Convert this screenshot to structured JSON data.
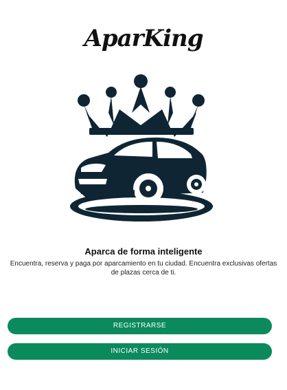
{
  "app": {
    "logo_text": "AparKing"
  },
  "hero": {
    "illustration": "crown-car-logo-icon"
  },
  "tagline": {
    "title": "Aparca de forma inteligente",
    "description": "Encuentra, reserva y paga por aparcamiento en tu ciudad. Encuentra exclusivas ofertas de plazas cerca de ti."
  },
  "actions": {
    "register_label": "REGISTRARSE",
    "login_label": "INICIAR SESIÓN"
  },
  "colors": {
    "primary": "#0b8a5e",
    "illustration": "#0f2533"
  }
}
